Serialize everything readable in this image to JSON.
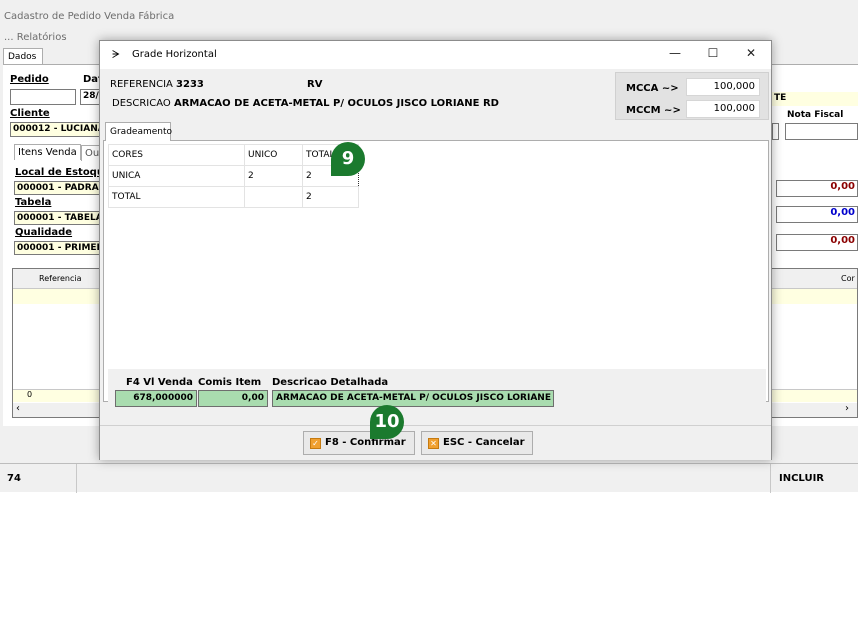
{
  "main": {
    "title": "Cadastro de Pedido Venda Fábrica",
    "menu_label": "...  Relatórios",
    "tab_dados": "Dados",
    "pedido_label": "Pedido",
    "data_label": "Dat",
    "date_value": "28/",
    "cliente_label": "Cliente",
    "cliente_value": "000012 - LUCIANA",
    "sub_tab_itens": "Itens Venda",
    "sub_tab_out": "Out",
    "local_label": "Local de Estoqu",
    "local_value": "000001 - PADRAC",
    "tabela_label": "Tabela",
    "tabela_value": "000001 - TABELA",
    "qualidade_label": "Qualidade",
    "qualidade_value": "000001 - PRIMEII",
    "right_te": "TE",
    "nota_fiscal_label": "Nota Fiscal",
    "val1": "0,00",
    "val2": "0,00",
    "val3": "0,00",
    "grid_col_referencia": "Referencia",
    "grid_col_cor": "Cor",
    "grid_footer_count": "0",
    "status_code": "74",
    "status_mode": "INCLUIR"
  },
  "dialog": {
    "title": "Grade Horizontal",
    "referencia_label": "REFERENCIA",
    "referencia_value": "3233",
    "rv": "RV",
    "descricao_label": "DESCRICAO",
    "descricao_value": "ARMACAO DE ACETA-METAL P/ OCULOS JISCO LORIANE RD",
    "mcca_label": "MCCA ~>",
    "mcca_value": "100,000",
    "mccm_label": "MCCM ~>",
    "mccm_value": "100,000",
    "tab_label": "Gradeamento",
    "grade": {
      "headers": [
        "CORES",
        "UNICO",
        "TOTAL"
      ],
      "rows": [
        [
          "UNICA",
          "2",
          "2"
        ],
        [
          "TOTAL",
          "",
          "2"
        ]
      ]
    },
    "f4_label": "F4 Vl Venda",
    "f4_value": "678,000000",
    "comis_label": "Comis Item",
    "comis_value": "0,00",
    "desc_det_label": "Descricao Detalhada",
    "desc_det_value": "ARMACAO DE ACETA-METAL P/ OCULOS JISCO LORIANE R",
    "confirm_button": "F8 - Confirmar",
    "cancel_button": "ESC - Cancelar"
  },
  "badges": {
    "step_9": "9",
    "step_10": "10"
  },
  "colors": {
    "badge_green": "#1b7a2e",
    "field_green": "#a9dcaf",
    "field_yellow": "#ffffe1",
    "value_red": "#8b0000",
    "value_blue": "#0000cc"
  }
}
